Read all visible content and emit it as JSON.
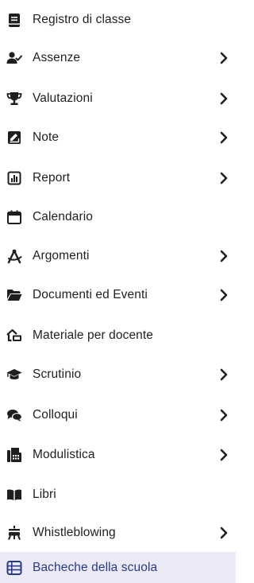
{
  "menu": {
    "items": [
      {
        "label": "Registro di classe",
        "icon": "journal-icon",
        "has_submenu": false
      },
      {
        "label": "Assenze",
        "icon": "user-check-icon",
        "has_submenu": true
      },
      {
        "label": "Valutazioni",
        "icon": "trophy-icon",
        "has_submenu": true
      },
      {
        "label": "Note",
        "icon": "note-icon",
        "has_submenu": true
      },
      {
        "label": "Report",
        "icon": "chart-icon",
        "has_submenu": true
      },
      {
        "label": "Calendario",
        "icon": "calendar-icon",
        "has_submenu": false
      },
      {
        "label": "Argomenti",
        "icon": "compass-icon",
        "has_submenu": true
      },
      {
        "label": "Documenti ed Eventi",
        "icon": "folder-icon",
        "has_submenu": true
      },
      {
        "label": "Materiale per docente",
        "icon": "teacher-material-icon",
        "has_submenu": false
      },
      {
        "label": "Scrutinio",
        "icon": "graduation-cap-icon",
        "has_submenu": true
      },
      {
        "label": "Colloqui",
        "icon": "chat-icon",
        "has_submenu": true
      },
      {
        "label": "Modulistica",
        "icon": "fax-icon",
        "has_submenu": true
      },
      {
        "label": "Libri",
        "icon": "book-open-icon",
        "has_submenu": false
      },
      {
        "label": "Whistleblowing",
        "icon": "whistle-icon",
        "has_submenu": true
      },
      {
        "label": "Bacheche della scuola",
        "icon": "list-board-icon",
        "has_submenu": false,
        "active": true
      }
    ]
  },
  "colors": {
    "icon": "#1f1f1f",
    "text": "#1f1f1f",
    "active_background": "#ebebf8",
    "active_accent": "#2a3a8a"
  }
}
